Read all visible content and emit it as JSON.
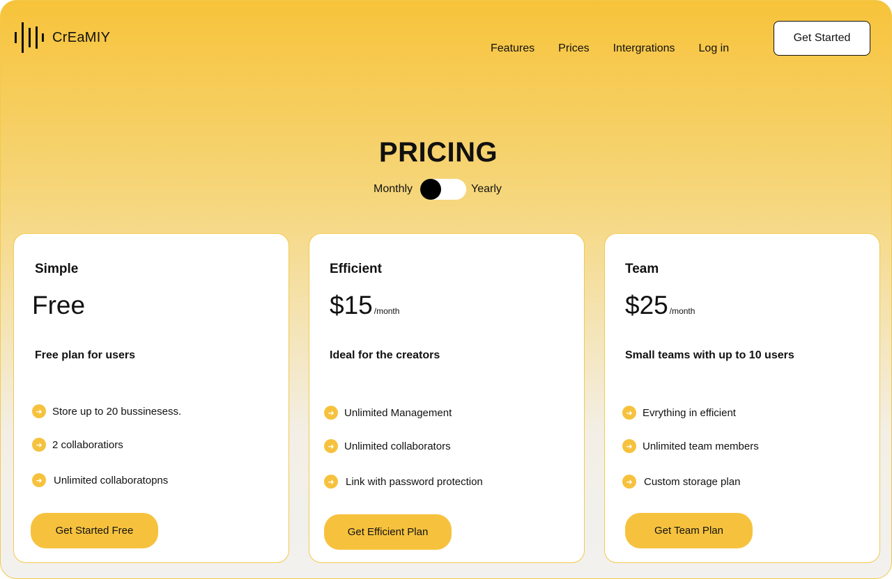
{
  "brand": {
    "name": "CrEaMIY",
    "logo_icon": "sound-wave-icon"
  },
  "nav": {
    "items": [
      {
        "label": "Features"
      },
      {
        "label": "Prices"
      },
      {
        "label": "Intergrations"
      },
      {
        "label": "Log in"
      }
    ],
    "cta_label": "Get Started"
  },
  "pricing": {
    "title": "PRICING",
    "toggle": {
      "left_label": "Monthly",
      "right_label": "Yearly",
      "selected": "Monthly"
    }
  },
  "plans": [
    {
      "name": "Simple",
      "price": "Free",
      "period": "",
      "description": "Free plan for users",
      "features": [
        "Store up to 20 bussinesess.",
        "2 collaboratiors",
        "Unlimited collaboratopns"
      ],
      "button_label": "Get Started Free"
    },
    {
      "name": "Efficient",
      "price": "$15",
      "period": "/month",
      "description": "Ideal for the creators",
      "features": [
        "Unlimited Management",
        "Unlimited collaborators",
        "Link with password protection"
      ],
      "button_label": "Get Efficient Plan"
    },
    {
      "name": "Team",
      "price": "$25",
      "period": "/month",
      "description": "Small teams with up to 10 users",
      "features": [
        "Evrything in efficient",
        "Unlimited team members",
        "Custom storage plan"
      ],
      "button_label": "Get Team Plan"
    }
  ],
  "colors": {
    "accent": "#f6c23e",
    "background_top": "#f7c33a",
    "background_bottom": "#f2f1ef",
    "toggle_knob": "#000000"
  },
  "icons": {
    "feature_bullet": "arrow-right-icon"
  }
}
